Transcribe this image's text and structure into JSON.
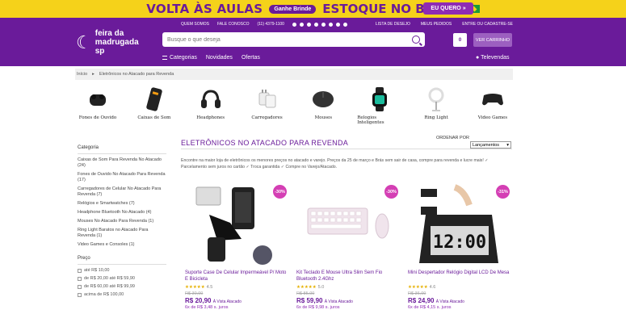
{
  "promo": {
    "left": "VOLTA ÀS AULAS",
    "pill": "Ganhe Brinde",
    "right": "ESTOQUE NO BRASIL",
    "cta": "EU QUERO »"
  },
  "header": {
    "logo": "feira da madrugada sp",
    "top_links": [
      "QUEM SOMOS",
      "FALE CONOSCO",
      "(11) 4379-1100"
    ],
    "account_links": [
      "LISTA DE DESEJO",
      "MEUS PEDIDOS",
      "ENTRE OU CADASTRE-SE"
    ],
    "search_placeholder": "Busque o que deseja",
    "cart_count": "0",
    "cart_button": "VER CARRINHO",
    "nav": [
      "Categorias",
      "Novidades",
      "Ofertas"
    ],
    "televendas": "Televendas"
  },
  "breadcrumb": [
    "Início",
    "Eletrônicos no Atacado para Revenda"
  ],
  "categories": [
    {
      "label": "Fones de Ouvido",
      "icon": "earbuds-icon"
    },
    {
      "label": "Caixas de Som",
      "icon": "speaker-icon"
    },
    {
      "label": "Headphones",
      "icon": "headphone-icon"
    },
    {
      "label": "Carregadores",
      "icon": "charger-icon"
    },
    {
      "label": "Mouses",
      "icon": "mouse-icon"
    },
    {
      "label": "Relogios Inteligentes",
      "icon": "smartwatch-icon"
    },
    {
      "label": "Ring Light",
      "icon": "ringlight-icon"
    },
    {
      "label": "Video Games",
      "icon": "gamepad-icon"
    }
  ],
  "sidebar": {
    "title": "Categoria",
    "items": [
      "Caixas de Som Para Revenda No Atacado (24)",
      "Fones de Ouvido No Atacado Para Revenda (17)",
      "Carregadores de Celular No Atacado Para Revenda (7)",
      "Relógios e Smartwatches (7)",
      "Headphone Bluetooth No Atacado (4)",
      "Mouses No Atacado Para Revenda (1)",
      "Ring Light Baratos no Atacado Para Revenda (1)",
      "Video Games e Consoles (1)"
    ],
    "price_title": "Preço",
    "price_items": [
      "até R$ 10,00",
      "de R$ 20,00 até R$ 59,90",
      "de R$ 60,00 até R$ 99,99",
      "acima de R$ 100,00"
    ]
  },
  "main": {
    "title": "ELETRÔNICOS NO ATACADO PARA REVENDA",
    "order_label": "ORDENAR POR",
    "sort_value": "Lançamentos",
    "description": "Encontre na maior loja de eletrônicos os menores preços no atacado e varejo. Preços da 25 de março e Brás sem sair de casa, compre para revenda e lucre mais! ✓ Parcelamento sem juros no cartão ✓ Troca garantida ✓ Compre no Varejo/Atacado."
  },
  "products": [
    {
      "discount": "-30%",
      "name": "Suporte Case De Celular Impermeável P/ Moto E Bicicleta",
      "rating": "4.5",
      "stars": "★★★★★",
      "old": "R$ 30,00",
      "price": "R$ 20,90",
      "price_note": "À Vista Atacado",
      "installments": "6x de R$ 3,48 s. juros"
    },
    {
      "discount": "-30%",
      "name": "Kit Teclado E Mouse Ultra Slim Sem Fio Bluetooth 2.4Ghz",
      "rating": "5.0",
      "stars": "★★★★★",
      "old": "R$ 85,00",
      "price": "R$ 59,90",
      "price_note": "À Vista Atacado",
      "installments": "6x de R$ 9,98 s. juros"
    },
    {
      "discount": "-31%",
      "name": "Mini Despertador Relógio Digital LCD De Mesa",
      "rating": "4.6",
      "stars": "★★★★★",
      "old": "R$ 36,00",
      "price": "R$ 24,90",
      "price_note": "À Vista Atacado",
      "installments": "6x de R$ 4,15 s. juros"
    }
  ]
}
